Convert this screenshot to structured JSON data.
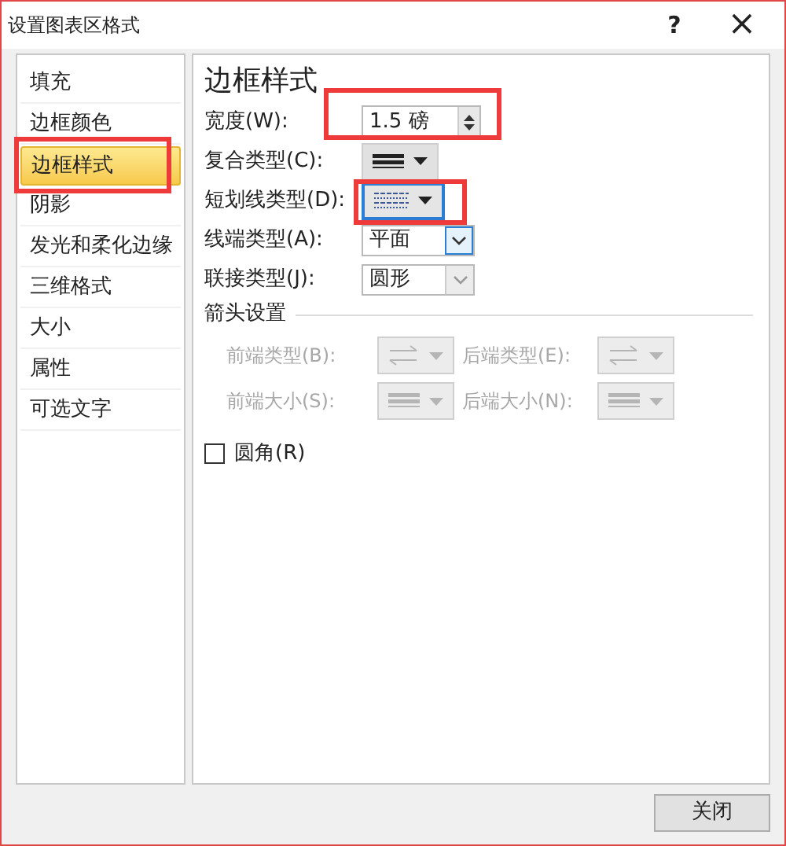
{
  "window": {
    "title": "设置图表区格式",
    "help": "?",
    "close": "×"
  },
  "sidebar": {
    "items": [
      {
        "label": "填充",
        "selected": false
      },
      {
        "label": "边框颜色",
        "selected": false
      },
      {
        "label": "边框样式",
        "selected": true
      },
      {
        "label": "阴影",
        "selected": false
      },
      {
        "label": "发光和柔化边缘",
        "selected": false
      },
      {
        "label": "三维格式",
        "selected": false
      },
      {
        "label": "大小",
        "selected": false
      },
      {
        "label": "属性",
        "selected": false
      },
      {
        "label": "可选文字",
        "selected": false
      }
    ]
  },
  "panel": {
    "heading": "边框样式",
    "rows": [
      {
        "kind": "spin",
        "label": "宽度(W):",
        "value": "1.5 磅"
      },
      {
        "kind": "compound",
        "label": "复合类型(C):",
        "focused": false
      },
      {
        "kind": "dash",
        "label": "短划线类型(D):",
        "focused": true
      },
      {
        "kind": "combo",
        "label": "线端类型(A):",
        "value": "平面",
        "focused": true
      },
      {
        "kind": "combo",
        "label": "联接类型(J):",
        "value": "圆形",
        "focused": false
      }
    ],
    "arrows": {
      "title": "箭头设置",
      "fields": [
        {
          "kind": "arrow",
          "label": "前端类型(B):",
          "disabled": true
        },
        {
          "kind": "arrow",
          "label": "后端类型(E):",
          "disabled": true
        },
        {
          "kind": "size",
          "label": "前端大小(S):",
          "disabled": true
        },
        {
          "kind": "size",
          "label": "后端大小(N):",
          "disabled": true
        }
      ]
    },
    "checkbox": {
      "label": "圆角(R)",
      "checked": false
    }
  },
  "buttons": [
    "关闭"
  ]
}
